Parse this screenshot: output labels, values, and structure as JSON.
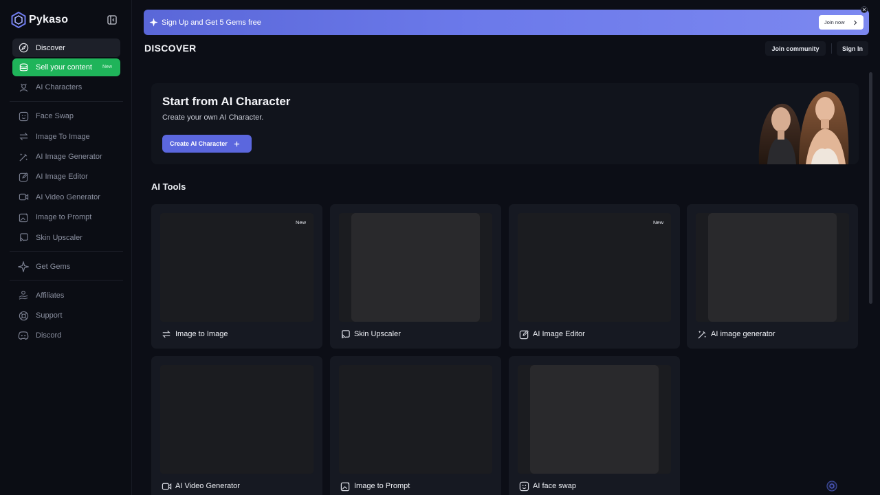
{
  "brand": {
    "name": "Pykaso"
  },
  "sidebar": {
    "items": [
      {
        "label": "Discover",
        "icon": "compass-icon"
      },
      {
        "label": "Sell your content",
        "icon": "coins-icon",
        "badge": "New"
      },
      {
        "label": "AI Characters",
        "icon": "character-icon"
      },
      {
        "label": "Face Swap",
        "icon": "face-scan-icon"
      },
      {
        "label": "Image To Image",
        "icon": "arrows-swap-icon"
      },
      {
        "label": "AI Image Generator",
        "icon": "wand-icon"
      },
      {
        "label": "AI Image Editor",
        "icon": "edit-icon"
      },
      {
        "label": "AI Video Generator",
        "icon": "video-icon"
      },
      {
        "label": "Image to Prompt",
        "icon": "image-prompt-icon"
      },
      {
        "label": "Skin Upscaler",
        "icon": "upscale-icon"
      },
      {
        "label": "Get Gems",
        "icon": "gem-sparkle-icon"
      },
      {
        "label": "Affiliates",
        "icon": "handshake-icon"
      },
      {
        "label": "Support",
        "icon": "lifebuoy-icon"
      },
      {
        "label": "Discord",
        "icon": "discord-icon"
      }
    ]
  },
  "banner": {
    "text": "Sign Up and Get 5 Gems free",
    "button": "Join now",
    "icon": "sparkle-icon"
  },
  "header": {
    "title": "DISCOVER",
    "join_community": "Join community",
    "sign_in": "Sign In"
  },
  "hero": {
    "title": "Start from AI Character",
    "subtitle": "Create your own AI Character.",
    "button": "Create AI Character"
  },
  "tools": {
    "title": "AI Tools",
    "cards": [
      {
        "label": "Image to Image",
        "badge": "New",
        "icon": "arrows-swap-icon"
      },
      {
        "label": "Skin Upscaler",
        "badge": "",
        "icon": "upscale-icon"
      },
      {
        "label": "AI Image Editor",
        "badge": "New",
        "icon": "edit-icon"
      },
      {
        "label": "AI image generator",
        "badge": "",
        "icon": "wand-icon"
      },
      {
        "label": "AI Video Generator",
        "badge": "",
        "icon": "video-icon"
      },
      {
        "label": "Image to Prompt",
        "badge": "",
        "icon": "image-prompt-icon"
      },
      {
        "label": "AI face swap",
        "badge": "",
        "icon": "face-scan-icon"
      }
    ]
  },
  "colors": {
    "accent": "#5b67de",
    "sell_green": "#1fb45a",
    "background": "#0c0e16",
    "card": "#161922"
  }
}
